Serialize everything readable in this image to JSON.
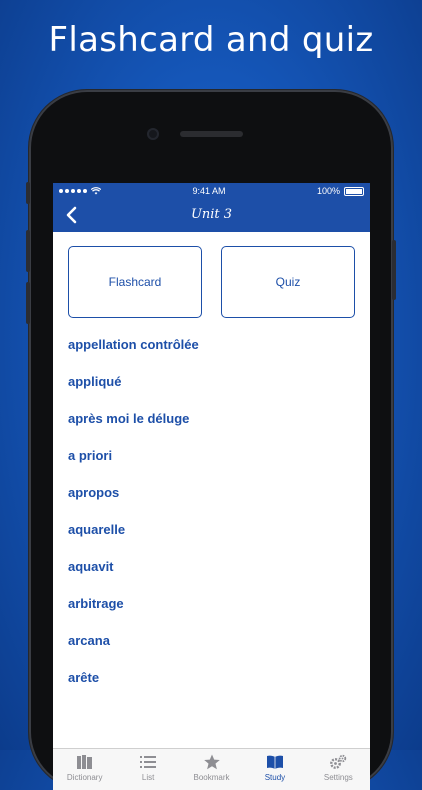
{
  "promo": {
    "headline": "Flashcard and quiz"
  },
  "status_bar": {
    "time": "9:41 AM",
    "battery": "100%"
  },
  "nav": {
    "title": "Unit 3",
    "back_icon": "chevron-left-icon"
  },
  "modes": [
    {
      "label": "Flashcard"
    },
    {
      "label": "Quiz"
    }
  ],
  "words": [
    "appellation contrôlée",
    "appliqué",
    "après moi le déluge",
    "a priori",
    "apropos",
    "aquarelle",
    "aquavit",
    "arbitrage",
    "arcana",
    "arête"
  ],
  "tabs": [
    {
      "label": "Dictionary",
      "icon": "books-icon",
      "active": false
    },
    {
      "label": "List",
      "icon": "list-icon",
      "active": false
    },
    {
      "label": "Bookmark",
      "icon": "star-icon",
      "active": false
    },
    {
      "label": "Study",
      "icon": "open-book-icon",
      "active": true
    },
    {
      "label": "Settings",
      "icon": "gears-icon",
      "active": false
    }
  ],
  "colors": {
    "accent": "#1d4fa8",
    "background": "#1556b8",
    "tab_inactive": "#8e8e93"
  }
}
